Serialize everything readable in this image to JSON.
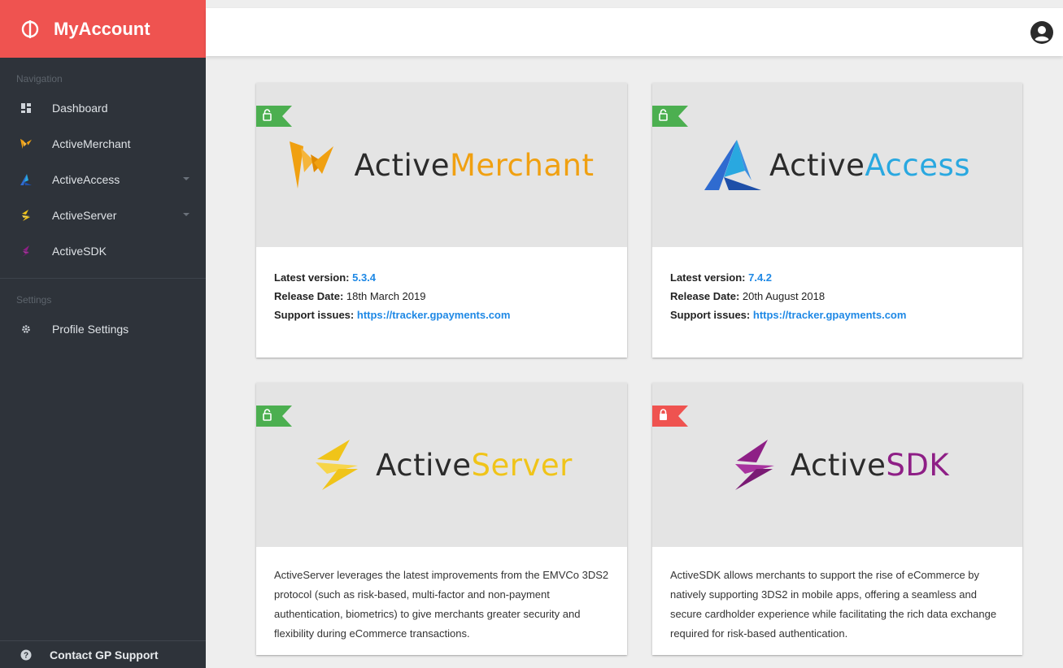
{
  "app": {
    "title": "MyAccount"
  },
  "sidebar": {
    "nav_section": "Navigation",
    "nav_items": [
      {
        "label": "Dashboard"
      },
      {
        "label": "ActiveMerchant"
      },
      {
        "label": "ActiveAccess"
      },
      {
        "label": "ActiveServer"
      },
      {
        "label": "ActiveSDK"
      }
    ],
    "settings_section": "Settings",
    "settings_items": [
      {
        "label": "Profile Settings"
      }
    ],
    "footer_label": "Contact GP Support"
  },
  "labels": {
    "latest_version": "Latest version:",
    "release_date": "Release Date:",
    "support_issues": "Support issues:"
  },
  "products": [
    {
      "logo_prefix": "Active",
      "logo_suffix": "Merchant",
      "version": "5.3.4",
      "release_date": "18th March 2019",
      "support_link": "https://tracker.gpayments.com",
      "lock_status": "unlocked"
    },
    {
      "logo_prefix": "Active",
      "logo_suffix": "Access",
      "version": "7.4.2",
      "release_date": "20th August 2018",
      "support_link": "https://tracker.gpayments.com",
      "lock_status": "unlocked"
    },
    {
      "logo_prefix": "Active",
      "logo_suffix": "Server",
      "description": "ActiveServer leverages the latest improvements from the EMVCo 3DS2 protocol (such as risk-based, multi-factor and non-payment authentication, biometrics) to give merchants greater security and flexibility during eCommerce transactions.",
      "lock_status": "unlocked"
    },
    {
      "logo_prefix": "Active",
      "logo_suffix": "SDK",
      "description": "ActiveSDK allows merchants to support the rise of eCommerce by natively supporting 3DS2 in mobile apps, offering a seamless and secure cardholder experience while facilitating the rich data exchange required for risk-based authentication.",
      "lock_status": "locked"
    }
  ],
  "colors": {
    "brand": "#ef5350",
    "sidebar": "#2e333a",
    "link": "#1e88e5",
    "ribbon_unlocked": "#4caf50",
    "ribbon_locked": "#ef5350",
    "merchant_accent": "#f0a011",
    "access_accent": "#29a8e0",
    "server_accent": "#f0c419",
    "sdk_accent": "#8e1f86"
  }
}
